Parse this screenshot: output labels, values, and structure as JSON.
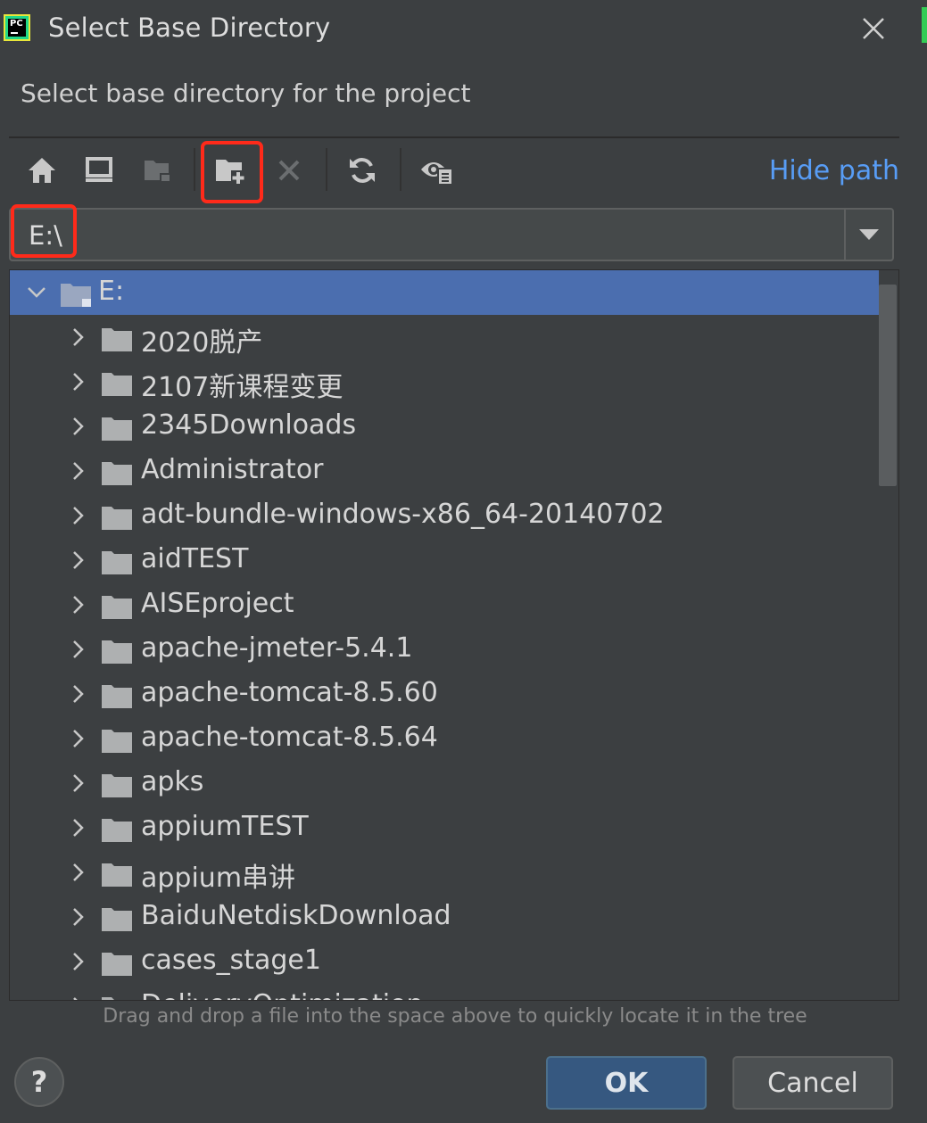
{
  "window": {
    "title": "Select Base Directory",
    "subtitle": "Select base directory for the project",
    "app_icon": "pycharm-logo",
    "app_icon_text": "PC"
  },
  "toolbar": {
    "buttons": [
      {
        "name": "home",
        "icon": "home-icon"
      },
      {
        "name": "desktop",
        "icon": "desktop-icon"
      },
      {
        "name": "project-folder",
        "icon": "project-folder-icon",
        "enabled": false
      },
      {
        "name": "new-folder",
        "icon": "new-folder-icon",
        "highlighted": true
      },
      {
        "name": "delete",
        "icon": "delete-icon",
        "enabled": false
      },
      {
        "name": "refresh",
        "icon": "refresh-icon"
      },
      {
        "name": "show-hidden",
        "icon": "show-hidden-icon"
      }
    ],
    "hide_path_label": "Hide path"
  },
  "path": {
    "value": "E:\\",
    "highlighted": true
  },
  "tree": {
    "root": {
      "label": "E:",
      "expanded": true,
      "selected": true
    },
    "items": [
      {
        "label": "2020脱产"
      },
      {
        "label": "2107新课程变更"
      },
      {
        "label": "2345Downloads"
      },
      {
        "label": "Administrator"
      },
      {
        "label": "adt-bundle-windows-x86_64-20140702"
      },
      {
        "label": "aidTEST"
      },
      {
        "label": "AISEproject"
      },
      {
        "label": "apache-jmeter-5.4.1"
      },
      {
        "label": "apache-tomcat-8.5.60"
      },
      {
        "label": "apache-tomcat-8.5.64"
      },
      {
        "label": "apks"
      },
      {
        "label": "appiumTEST"
      },
      {
        "label": "appium串讲"
      },
      {
        "label": "BaiduNetdiskDownload"
      },
      {
        "label": "cases_stage1"
      },
      {
        "label": "DeliveryOptimization"
      }
    ]
  },
  "hint": "Drag and drop a file into the space above to quickly locate it in the tree",
  "footer": {
    "help_label": "?",
    "ok_label": "OK",
    "cancel_label": "Cancel"
  },
  "colors": {
    "background": "#3c3f41",
    "selection": "#4b6eaf",
    "link": "#589df6",
    "highlight": "#ff2a1a",
    "ok_button": "#365880"
  }
}
